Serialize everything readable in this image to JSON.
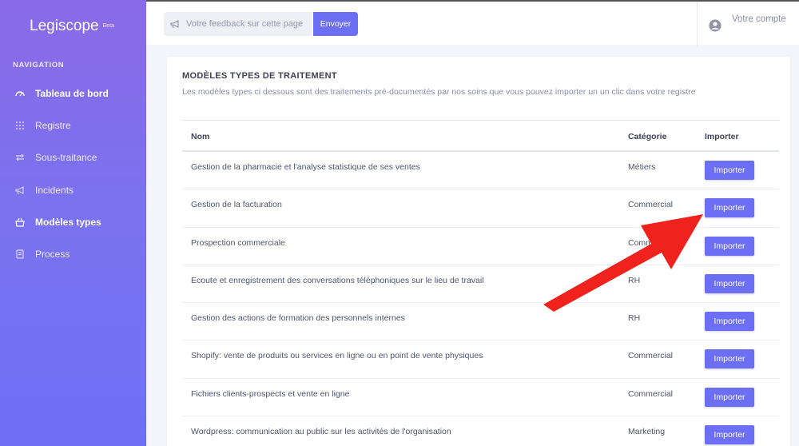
{
  "app": {
    "brand": "Legiscope",
    "badge": "Beta"
  },
  "nav": {
    "heading": "NAVIGATION",
    "items": [
      {
        "label": "Tableau de bord",
        "icon": "speedometer-icon"
      },
      {
        "label": "Registre",
        "icon": "grid-dots-icon"
      },
      {
        "label": "Sous-traitance",
        "icon": "arrows-icon"
      },
      {
        "label": "Incidents",
        "icon": "megaphone-icon"
      },
      {
        "label": "Modèles types",
        "icon": "basket-icon"
      },
      {
        "label": "Process",
        "icon": "document-icon"
      }
    ]
  },
  "topbar": {
    "feedback_placeholder": "Votre feedback sur cette page",
    "send_label": "Envoyer",
    "account_label": "Votre compte"
  },
  "page": {
    "title": "MODÈLES TYPES DE TRAITEMENT",
    "subtitle": "Les modèles types ci dessous sont des traitements pré-documentés par nos soins que vous pouvez importer un un clic dans votre registre"
  },
  "table": {
    "headers": {
      "name": "Nom",
      "category": "Catégorie",
      "import": "Importer"
    },
    "rows": [
      {
        "name": "Gestion de la pharmacie et l'analyse statistique de ses ventes",
        "category": "Métiers",
        "button": "Importer"
      },
      {
        "name": "Gestion de la facturation",
        "category": "Commercial",
        "button": "Importer"
      },
      {
        "name": "Prospection commerciale",
        "category": "Commercial",
        "button": "Importer"
      },
      {
        "name": "Ecoute et enregistrement des conversations téléphoniques sur le lieu de travail",
        "category": "RH",
        "button": "Importer"
      },
      {
        "name": "Gestion des actions de formation des personnels internes",
        "category": "RH",
        "button": "Importer"
      },
      {
        "name": "Shopify: vente de produits ou services en ligne ou en point de vente physiques",
        "category": "Commercial",
        "button": "Importer"
      },
      {
        "name": "Fichiers clients-prospects et vente en ligne",
        "category": "Commercial",
        "button": "Importer"
      },
      {
        "name": "Wordpress: communication au public sur les activités de l'organisation",
        "category": "Marketing",
        "button": "Importer"
      }
    ]
  },
  "colors": {
    "accent": "#6c6ef3",
    "annotation_arrow": "#f0221d"
  }
}
